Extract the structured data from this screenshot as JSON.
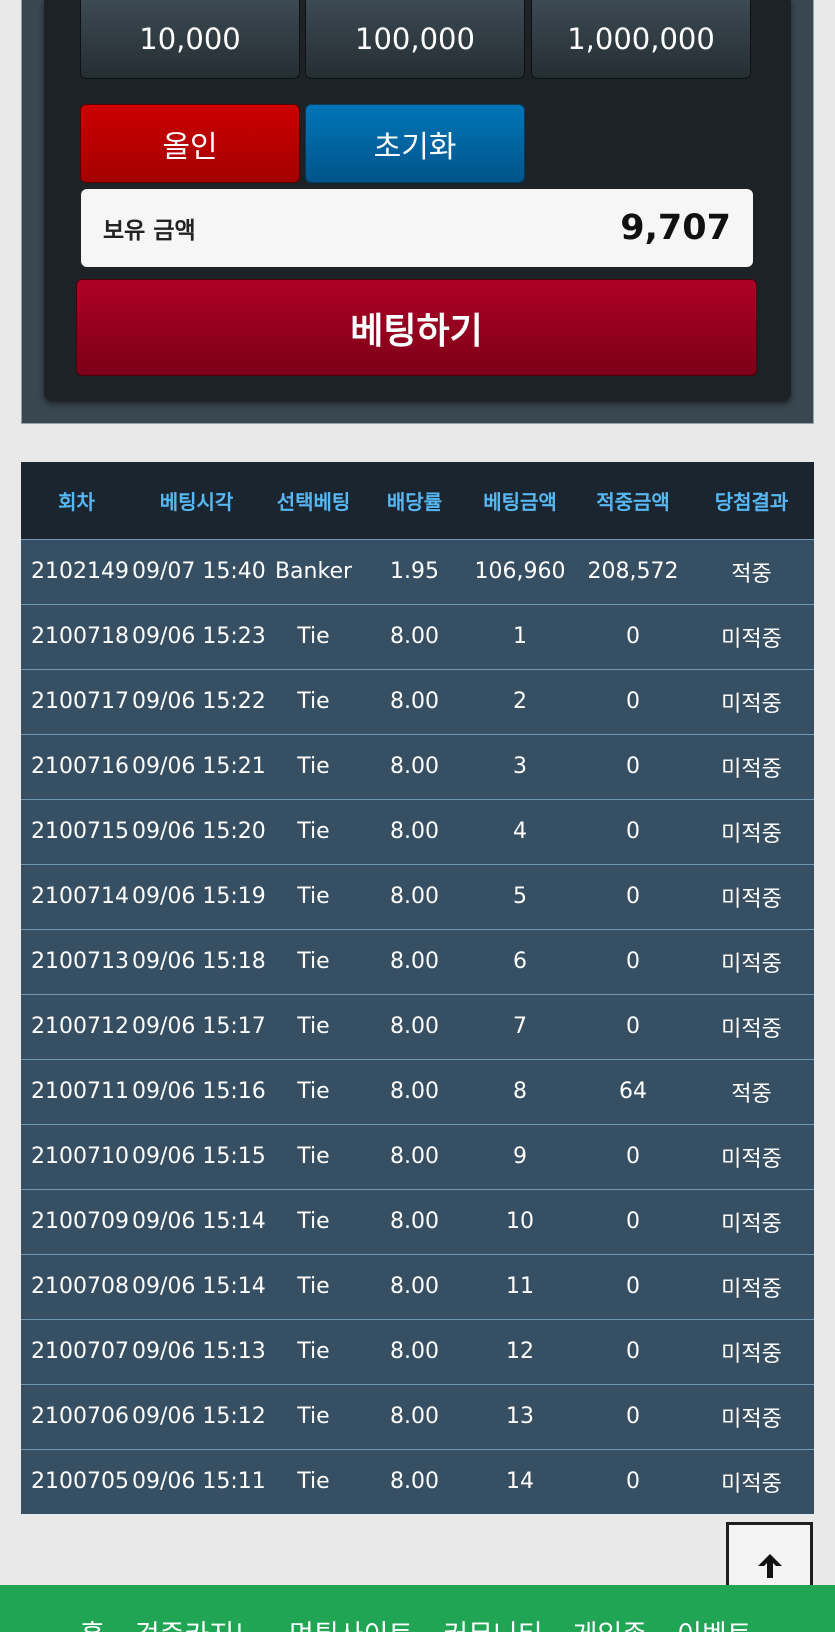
{
  "chips": [
    "10,000",
    "100,000",
    "1,000,000"
  ],
  "actions": {
    "allin_label": "올인",
    "reset_label": "초기화",
    "bet_label": "베팅하기"
  },
  "balance": {
    "label": "보유 금액",
    "value": "9,707"
  },
  "colors": {
    "win": "#f1b429",
    "lose": "#c51a1a",
    "header_text": "#57b7f2",
    "nav_green": "#1fa553"
  },
  "table": {
    "headers": [
      "회차",
      "베팅시각",
      "선택베팅",
      "배당률",
      "베팅금액",
      "적중금액",
      "당첨결과"
    ],
    "rows": [
      {
        "round": "2102149",
        "time": "09/07 15:40",
        "pick": "Banker",
        "odds": "1.95",
        "bet": "106,960",
        "payout": "208,572",
        "result": "적중",
        "status": "win"
      },
      {
        "round": "2100718",
        "time": "09/06 15:23",
        "pick": "Tie",
        "odds": "8.00",
        "bet": "1",
        "payout": "0",
        "result": "미적중",
        "status": "lose"
      },
      {
        "round": "2100717",
        "time": "09/06 15:22",
        "pick": "Tie",
        "odds": "8.00",
        "bet": "2",
        "payout": "0",
        "result": "미적중",
        "status": "lose"
      },
      {
        "round": "2100716",
        "time": "09/06 15:21",
        "pick": "Tie",
        "odds": "8.00",
        "bet": "3",
        "payout": "0",
        "result": "미적중",
        "status": "lose"
      },
      {
        "round": "2100715",
        "time": "09/06 15:20",
        "pick": "Tie",
        "odds": "8.00",
        "bet": "4",
        "payout": "0",
        "result": "미적중",
        "status": "lose"
      },
      {
        "round": "2100714",
        "time": "09/06 15:19",
        "pick": "Tie",
        "odds": "8.00",
        "bet": "5",
        "payout": "0",
        "result": "미적중",
        "status": "lose"
      },
      {
        "round": "2100713",
        "time": "09/06 15:18",
        "pick": "Tie",
        "odds": "8.00",
        "bet": "6",
        "payout": "0",
        "result": "미적중",
        "status": "lose"
      },
      {
        "round": "2100712",
        "time": "09/06 15:17",
        "pick": "Tie",
        "odds": "8.00",
        "bet": "7",
        "payout": "0",
        "result": "미적중",
        "status": "lose"
      },
      {
        "round": "2100711",
        "time": "09/06 15:16",
        "pick": "Tie",
        "odds": "8.00",
        "bet": "8",
        "payout": "64",
        "result": "적중",
        "status": "win"
      },
      {
        "round": "2100710",
        "time": "09/06 15:15",
        "pick": "Tie",
        "odds": "8.00",
        "bet": "9",
        "payout": "0",
        "result": "미적중",
        "status": "lose"
      },
      {
        "round": "2100709",
        "time": "09/06 15:14",
        "pick": "Tie",
        "odds": "8.00",
        "bet": "10",
        "payout": "0",
        "result": "미적중",
        "status": "lose"
      },
      {
        "round": "2100708",
        "time": "09/06 15:14",
        "pick": "Tie",
        "odds": "8.00",
        "bet": "11",
        "payout": "0",
        "result": "미적중",
        "status": "lose"
      },
      {
        "round": "2100707",
        "time": "09/06 15:13",
        "pick": "Tie",
        "odds": "8.00",
        "bet": "12",
        "payout": "0",
        "result": "미적중",
        "status": "lose"
      },
      {
        "round": "2100706",
        "time": "09/06 15:12",
        "pick": "Tie",
        "odds": "8.00",
        "bet": "13",
        "payout": "0",
        "result": "미적중",
        "status": "lose"
      },
      {
        "round": "2100705",
        "time": "09/06 15:11",
        "pick": "Tie",
        "odds": "8.00",
        "bet": "14",
        "payout": "0",
        "result": "미적중",
        "status": "lose"
      }
    ]
  },
  "scroll_top_icon": "arrow-up-icon",
  "bottom_nav": [
    "홈",
    "검증카지노",
    "먹튀사이트",
    "커뮤니티",
    "게임존",
    "이벤트"
  ]
}
